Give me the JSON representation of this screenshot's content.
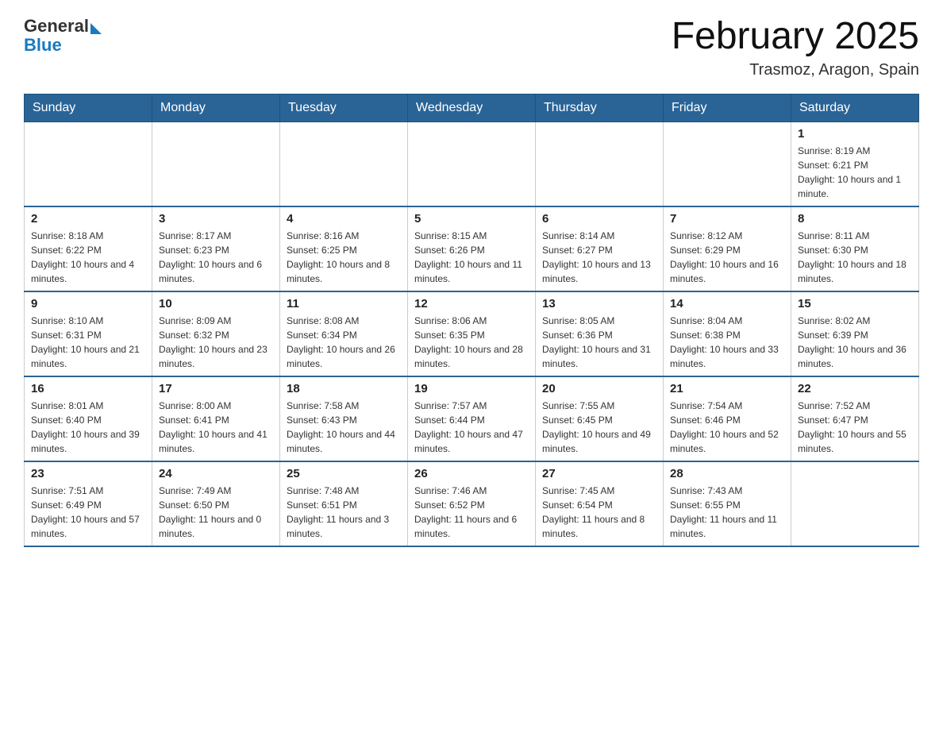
{
  "header": {
    "logo_general": "General",
    "logo_blue": "Blue",
    "title": "February 2025",
    "subtitle": "Trasmoz, Aragon, Spain"
  },
  "days_of_week": [
    "Sunday",
    "Monday",
    "Tuesday",
    "Wednesday",
    "Thursday",
    "Friday",
    "Saturday"
  ],
  "weeks": [
    [
      {
        "day": "",
        "sunrise": "",
        "sunset": "",
        "daylight": ""
      },
      {
        "day": "",
        "sunrise": "",
        "sunset": "",
        "daylight": ""
      },
      {
        "day": "",
        "sunrise": "",
        "sunset": "",
        "daylight": ""
      },
      {
        "day": "",
        "sunrise": "",
        "sunset": "",
        "daylight": ""
      },
      {
        "day": "",
        "sunrise": "",
        "sunset": "",
        "daylight": ""
      },
      {
        "day": "",
        "sunrise": "",
        "sunset": "",
        "daylight": ""
      },
      {
        "day": "1",
        "sunrise": "Sunrise: 8:19 AM",
        "sunset": "Sunset: 6:21 PM",
        "daylight": "Daylight: 10 hours and 1 minute."
      }
    ],
    [
      {
        "day": "2",
        "sunrise": "Sunrise: 8:18 AM",
        "sunset": "Sunset: 6:22 PM",
        "daylight": "Daylight: 10 hours and 4 minutes."
      },
      {
        "day": "3",
        "sunrise": "Sunrise: 8:17 AM",
        "sunset": "Sunset: 6:23 PM",
        "daylight": "Daylight: 10 hours and 6 minutes."
      },
      {
        "day": "4",
        "sunrise": "Sunrise: 8:16 AM",
        "sunset": "Sunset: 6:25 PM",
        "daylight": "Daylight: 10 hours and 8 minutes."
      },
      {
        "day": "5",
        "sunrise": "Sunrise: 8:15 AM",
        "sunset": "Sunset: 6:26 PM",
        "daylight": "Daylight: 10 hours and 11 minutes."
      },
      {
        "day": "6",
        "sunrise": "Sunrise: 8:14 AM",
        "sunset": "Sunset: 6:27 PM",
        "daylight": "Daylight: 10 hours and 13 minutes."
      },
      {
        "day": "7",
        "sunrise": "Sunrise: 8:12 AM",
        "sunset": "Sunset: 6:29 PM",
        "daylight": "Daylight: 10 hours and 16 minutes."
      },
      {
        "day": "8",
        "sunrise": "Sunrise: 8:11 AM",
        "sunset": "Sunset: 6:30 PM",
        "daylight": "Daylight: 10 hours and 18 minutes."
      }
    ],
    [
      {
        "day": "9",
        "sunrise": "Sunrise: 8:10 AM",
        "sunset": "Sunset: 6:31 PM",
        "daylight": "Daylight: 10 hours and 21 minutes."
      },
      {
        "day": "10",
        "sunrise": "Sunrise: 8:09 AM",
        "sunset": "Sunset: 6:32 PM",
        "daylight": "Daylight: 10 hours and 23 minutes."
      },
      {
        "day": "11",
        "sunrise": "Sunrise: 8:08 AM",
        "sunset": "Sunset: 6:34 PM",
        "daylight": "Daylight: 10 hours and 26 minutes."
      },
      {
        "day": "12",
        "sunrise": "Sunrise: 8:06 AM",
        "sunset": "Sunset: 6:35 PM",
        "daylight": "Daylight: 10 hours and 28 minutes."
      },
      {
        "day": "13",
        "sunrise": "Sunrise: 8:05 AM",
        "sunset": "Sunset: 6:36 PM",
        "daylight": "Daylight: 10 hours and 31 minutes."
      },
      {
        "day": "14",
        "sunrise": "Sunrise: 8:04 AM",
        "sunset": "Sunset: 6:38 PM",
        "daylight": "Daylight: 10 hours and 33 minutes."
      },
      {
        "day": "15",
        "sunrise": "Sunrise: 8:02 AM",
        "sunset": "Sunset: 6:39 PM",
        "daylight": "Daylight: 10 hours and 36 minutes."
      }
    ],
    [
      {
        "day": "16",
        "sunrise": "Sunrise: 8:01 AM",
        "sunset": "Sunset: 6:40 PM",
        "daylight": "Daylight: 10 hours and 39 minutes."
      },
      {
        "day": "17",
        "sunrise": "Sunrise: 8:00 AM",
        "sunset": "Sunset: 6:41 PM",
        "daylight": "Daylight: 10 hours and 41 minutes."
      },
      {
        "day": "18",
        "sunrise": "Sunrise: 7:58 AM",
        "sunset": "Sunset: 6:43 PM",
        "daylight": "Daylight: 10 hours and 44 minutes."
      },
      {
        "day": "19",
        "sunrise": "Sunrise: 7:57 AM",
        "sunset": "Sunset: 6:44 PM",
        "daylight": "Daylight: 10 hours and 47 minutes."
      },
      {
        "day": "20",
        "sunrise": "Sunrise: 7:55 AM",
        "sunset": "Sunset: 6:45 PM",
        "daylight": "Daylight: 10 hours and 49 minutes."
      },
      {
        "day": "21",
        "sunrise": "Sunrise: 7:54 AM",
        "sunset": "Sunset: 6:46 PM",
        "daylight": "Daylight: 10 hours and 52 minutes."
      },
      {
        "day": "22",
        "sunrise": "Sunrise: 7:52 AM",
        "sunset": "Sunset: 6:47 PM",
        "daylight": "Daylight: 10 hours and 55 minutes."
      }
    ],
    [
      {
        "day": "23",
        "sunrise": "Sunrise: 7:51 AM",
        "sunset": "Sunset: 6:49 PM",
        "daylight": "Daylight: 10 hours and 57 minutes."
      },
      {
        "day": "24",
        "sunrise": "Sunrise: 7:49 AM",
        "sunset": "Sunset: 6:50 PM",
        "daylight": "Daylight: 11 hours and 0 minutes."
      },
      {
        "day": "25",
        "sunrise": "Sunrise: 7:48 AM",
        "sunset": "Sunset: 6:51 PM",
        "daylight": "Daylight: 11 hours and 3 minutes."
      },
      {
        "day": "26",
        "sunrise": "Sunrise: 7:46 AM",
        "sunset": "Sunset: 6:52 PM",
        "daylight": "Daylight: 11 hours and 6 minutes."
      },
      {
        "day": "27",
        "sunrise": "Sunrise: 7:45 AM",
        "sunset": "Sunset: 6:54 PM",
        "daylight": "Daylight: 11 hours and 8 minutes."
      },
      {
        "day": "28",
        "sunrise": "Sunrise: 7:43 AM",
        "sunset": "Sunset: 6:55 PM",
        "daylight": "Daylight: 11 hours and 11 minutes."
      },
      {
        "day": "",
        "sunrise": "",
        "sunset": "",
        "daylight": ""
      }
    ]
  ]
}
